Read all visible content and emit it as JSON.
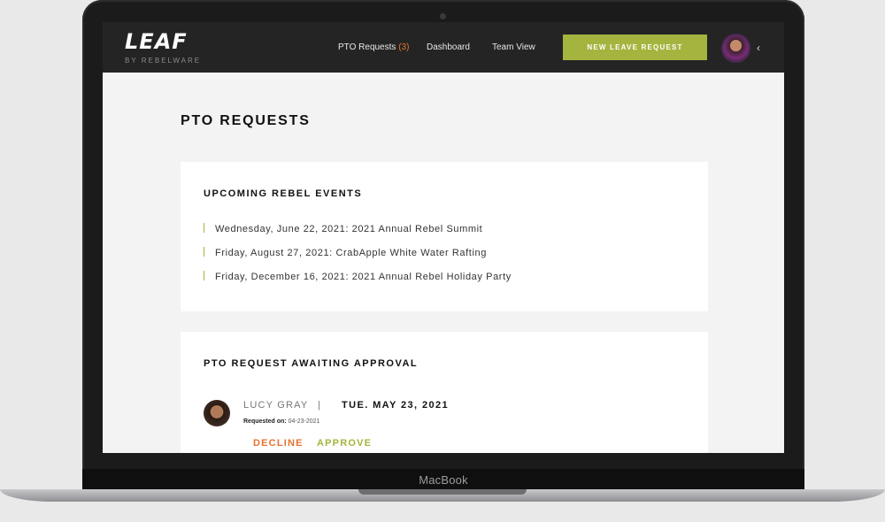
{
  "app": {
    "logo_text": "LEAF",
    "logo_sub": "BY REBELWARE"
  },
  "nav": {
    "pto_requests_label": "PTO Requests",
    "pto_requests_count": "(3)",
    "dashboard_label": "Dashboard",
    "team_view_label": "Team View",
    "new_leave_label": "NEW LEAVE REQUEST",
    "chevron": "‹"
  },
  "page": {
    "title": "PTO REQUESTS"
  },
  "events": {
    "title": "UPCOMING REBEL EVENTS",
    "items": [
      "Wednesday, June 22, 2021: 2021 Annual Rebel Summit",
      "Friday, August 27, 2021: CrabApple White Water Rafting",
      "Friday, December 16, 2021: 2021 Annual Rebel Holiday Party"
    ]
  },
  "approval": {
    "title": "PTO REQUEST AWAITING APPROVAL",
    "requester": "LUCY GRAY",
    "divider": "|",
    "date": "TUE. MAY 23, 2021",
    "requested_on_label": "Requested on:",
    "requested_on_value": "04-23-2021",
    "decline_label": "DECLINE",
    "approve_label": "APPROVE"
  },
  "device": {
    "brand": "MacBook"
  },
  "colors": {
    "accent_green": "#a5b43f",
    "accent_orange": "#e5722f",
    "header_bg": "#242424"
  }
}
